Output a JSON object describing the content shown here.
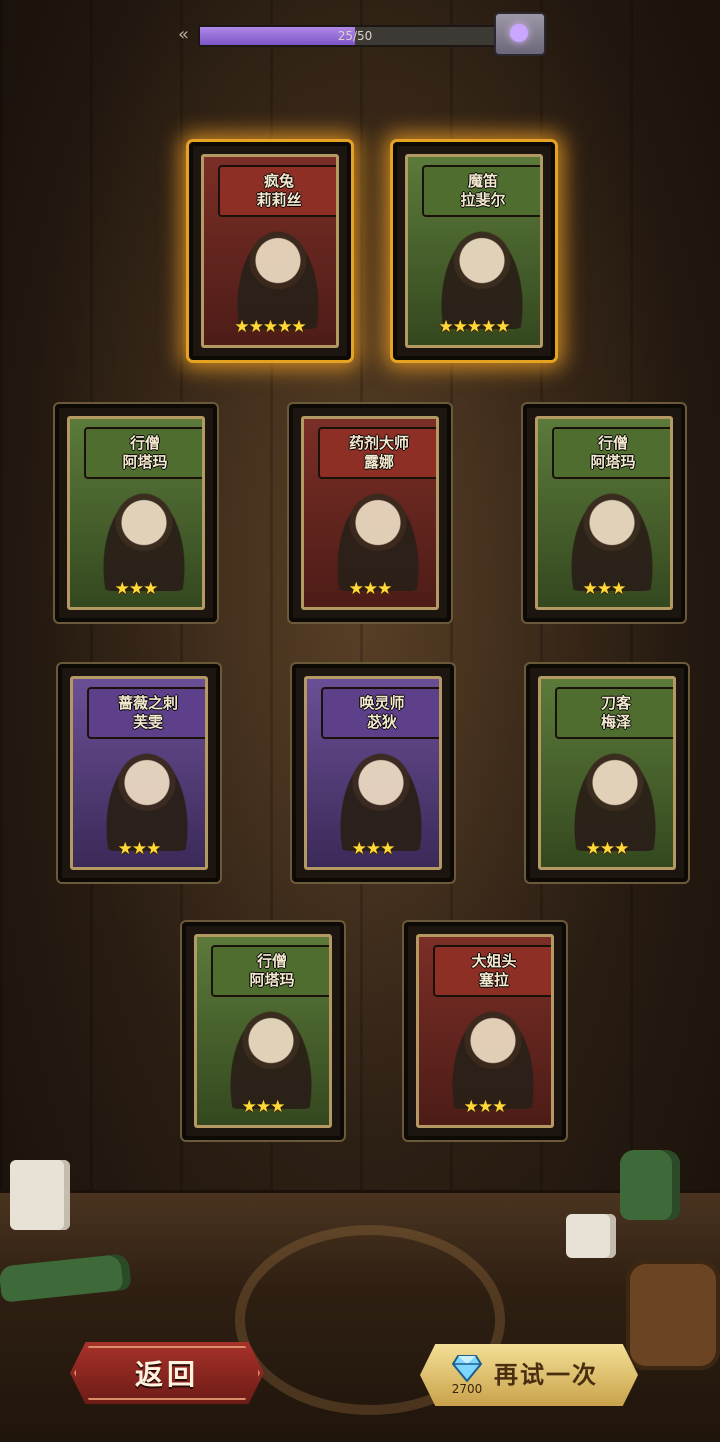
{
  "progress": {
    "text": "25/50",
    "value": 25,
    "max": 50,
    "fraction": 0.5
  },
  "cards": [
    {
      "title": "疯兔",
      "name": "莉莉丝",
      "stars": "★★★★★",
      "star_count": 5,
      "theme": "red",
      "glow": true
    },
    {
      "title": "魔笛",
      "name": "拉斐尔",
      "stars": "★★★★★",
      "star_count": 5,
      "theme": "green",
      "glow": true
    },
    {
      "title": "行僧",
      "name": "阿塔玛",
      "stars": "★★★",
      "star_count": 3,
      "theme": "green",
      "glow": false
    },
    {
      "title": "药剂大师",
      "name": "露娜",
      "stars": "★★★",
      "star_count": 3,
      "theme": "red",
      "glow": false
    },
    {
      "title": "行僧",
      "name": "阿塔玛",
      "stars": "★★★",
      "star_count": 3,
      "theme": "green",
      "glow": false
    },
    {
      "title": "蔷薇之刺",
      "name": "芙雯",
      "stars": "★★★",
      "star_count": 3,
      "theme": "purple",
      "glow": false
    },
    {
      "title": "唤灵师",
      "name": "苾狄",
      "stars": "★★★",
      "star_count": 3,
      "theme": "purple",
      "glow": false
    },
    {
      "title": "刀客",
      "name": "梅泽",
      "stars": "★★★",
      "star_count": 3,
      "theme": "green",
      "glow": false
    },
    {
      "title": "行僧",
      "name": "阿塔玛",
      "stars": "★★★",
      "star_count": 3,
      "theme": "green",
      "glow": false
    },
    {
      "title": "大姐头",
      "name": "塞拉",
      "stars": "★★★",
      "star_count": 3,
      "theme": "red",
      "glow": false
    }
  ],
  "buttons": {
    "back_label": "返回",
    "retry_label": "再试一次",
    "retry_cost": "2700",
    "retry_cost_icon": "diamond-icon"
  },
  "colors": {
    "glow": "#e6a322",
    "progress_fill": "#8f66d6",
    "star": "#ffd93a"
  }
}
